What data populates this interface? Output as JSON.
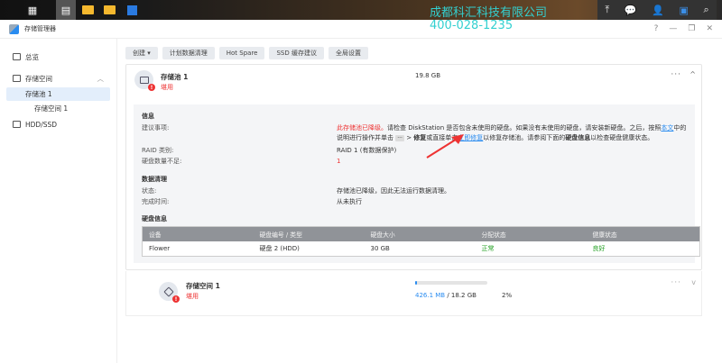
{
  "watermark": {
    "company": "成都科汇科技有限公司",
    "phone": "400-028-1235"
  },
  "window": {
    "title": "存储管理器",
    "help": "?",
    "minimize": "—",
    "restore": "❐",
    "close": "✕"
  },
  "sidebar": {
    "items": [
      {
        "label": "总览"
      },
      {
        "label": "存储空间"
      },
      {
        "label": "存储池 1"
      },
      {
        "label": "存储空间 1"
      },
      {
        "label": "HDD/SSD"
      }
    ]
  },
  "toolbar": {
    "create": "创建 ▾",
    "scrub": "计划数据清理",
    "hotspare": "Hot Spare",
    "ssd": "SSD 缓存建议",
    "global": "全局设置"
  },
  "pool": {
    "name": "存储池 1",
    "status": "堪用",
    "size": "19.8 GB",
    "more": "···",
    "collapse": "^",
    "info_title": "信息",
    "advice_label": "建议事项:",
    "advice_red": "此存储池已降级。",
    "advice_1": "请检查 DiskStation 是否包含未使用的硬盘。如果没有未使用的硬盘，请安装新硬盘。之后，按照",
    "advice_link1": "本文",
    "advice_2": "中的说明进行操作并单击",
    "advice_dots": "···",
    "advice_3": " > ",
    "advice_repair": "修复",
    "advice_4": "或直接单击",
    "advice_link2": "立即修复",
    "advice_5": "以修复存储池。请参阅下面的",
    "advice_diskinfo": "硬盘信息",
    "advice_6": "以检查硬盘健康状态。",
    "raid_label": "RAID 类别:",
    "raid_value": "RAID 1 (有数据保护)",
    "missing_label": "硬盘数量不足:",
    "missing_value": "1",
    "scrub_title": "数据清理",
    "state_label": "状态:",
    "state_value": "存储池已降级，因此无法运行数据清理。",
    "done_label": "完成时间:",
    "done_value": "从未执行",
    "disk_title": "硬盘信息",
    "table": {
      "headers": [
        "设备",
        "硬盘编号 / 类型",
        "硬盘大小",
        "分配状态",
        "健康状态"
      ],
      "rows": [
        [
          "Flower",
          "硬盘 2 (HDD)",
          "30 GB",
          "正常",
          "良好"
        ]
      ]
    }
  },
  "volume": {
    "name": "存储空间 1",
    "status": "堪用",
    "used": "426.1 MB",
    "total": " / 18.2 GB",
    "percent": "2%",
    "usage_fraction": 0.02,
    "more": "···",
    "expand": "v"
  }
}
